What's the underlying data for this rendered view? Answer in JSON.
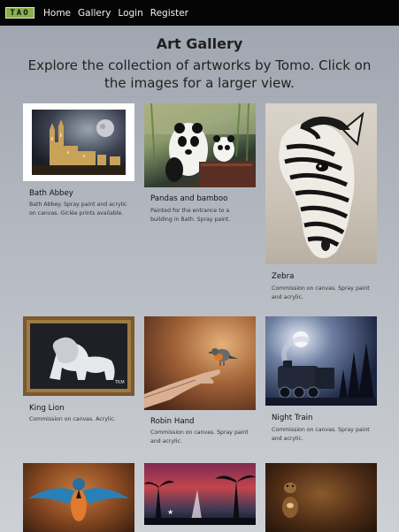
{
  "navbar": {
    "logo_text": "TAO",
    "links": [
      "Home",
      "Gallery",
      "Login",
      "Register"
    ]
  },
  "header": {
    "title": "Art Gallery",
    "subtitle": "Explore the collection of artworks by Tomo. Click on the images for a larger view."
  },
  "artworks": [
    {
      "title": "Bath Abbey",
      "description": "Bath Abbey. Spray paint and acrylic on canvas. Giclée prints available."
    },
    {
      "title": "Pandas and bamboo",
      "description": "Painted for the entrance to a building in Bath. Spray paint."
    },
    {
      "title": "Zebra",
      "description": "Commission on canvas. Spray paint and acrylic."
    },
    {
      "title": "King Lion",
      "description": "Commission on canvas. Acrylic."
    },
    {
      "title": "Robin Hand",
      "description": "Commission on canvas. Spray paint and acrylic."
    },
    {
      "title": "Night Train",
      "description": "Commission on canvas. Spray paint and acrylic."
    },
    {
      "title": "",
      "description": ""
    },
    {
      "title": "",
      "description": ""
    },
    {
      "title": "",
      "description": ""
    }
  ],
  "artwork_signature": "TKM"
}
